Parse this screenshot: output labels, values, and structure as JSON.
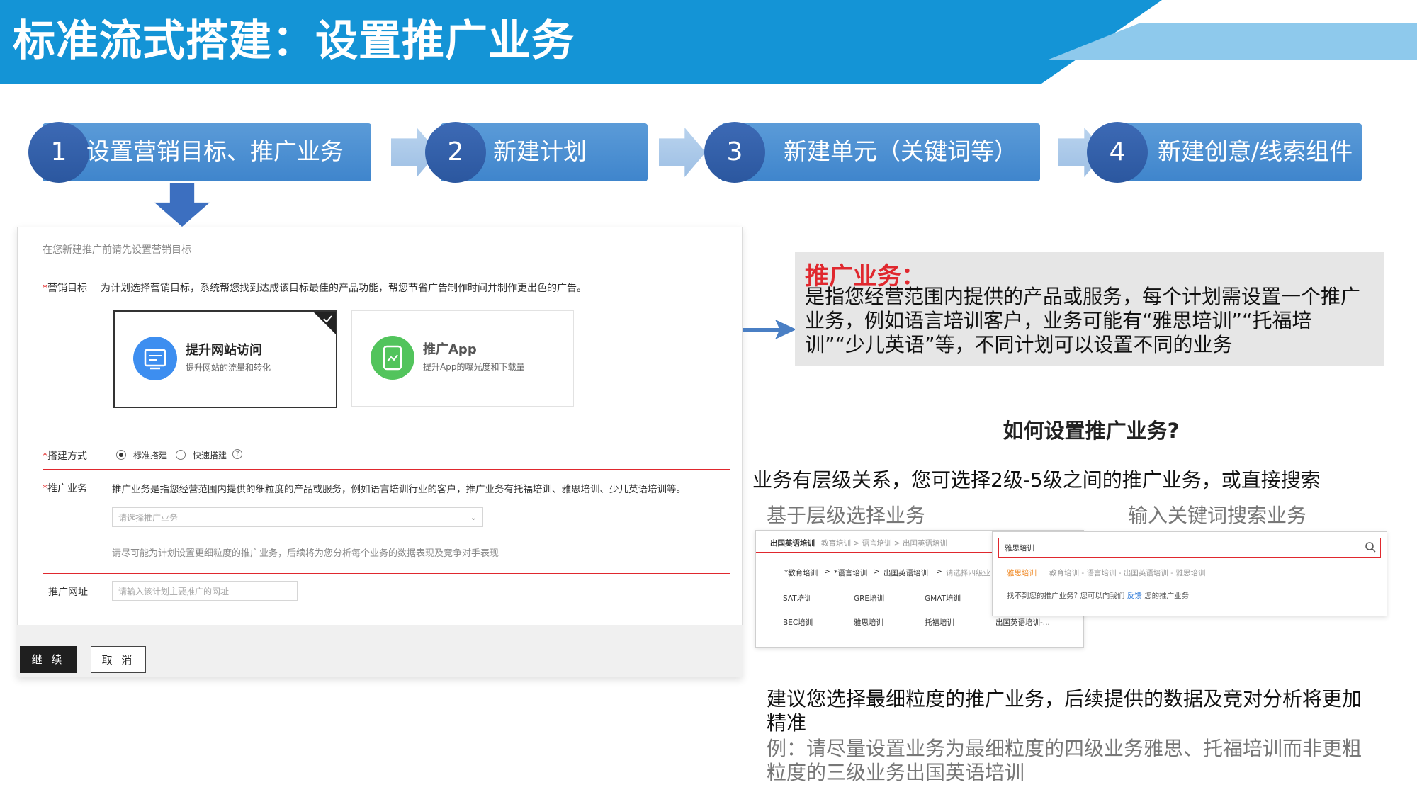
{
  "header": {
    "title": "标准流式搭建：设置推广业务"
  },
  "steps": [
    {
      "num": "1",
      "label": "设置营销目标、推广业务"
    },
    {
      "num": "2",
      "label": "新建计划"
    },
    {
      "num": "3",
      "label": "新建单元（关键词等）"
    },
    {
      "num": "4",
      "label": "新建创意/线索组件"
    }
  ],
  "form": {
    "intro": "在您新建推广前请先设置营销目标",
    "goal_label": "营销目标",
    "goal_desc": "为计划选择营销目标，系统帮您找到达成该目标最佳的产品功能，帮您节省广告制作时间并制作更出色的广告。",
    "cards": [
      {
        "title": "提升网站访问",
        "subtitle": "提升网站的流量和转化",
        "icon": "monitor-icon",
        "color": "#3d8ef0"
      },
      {
        "title": "推广App",
        "subtitle": "提升App的曝光度和下载量",
        "icon": "app-icon",
        "color": "#52c45c"
      }
    ],
    "build_label": "搭建方式",
    "build_options": [
      "标准搭建",
      "快速搭建"
    ],
    "business_label": "推广业务",
    "business_desc": "推广业务是指您经营范围内提供的细粒度的产品或服务，例如语言培训行业的客户，推广业务有托福培训、雅思培训、少儿英语培训等。",
    "business_placeholder": "请选择推广业务",
    "business_hint": "请尽可能为计划设置更细粒度的推广业务，后续将为您分析每个业务的数据表现及竞争对手表现",
    "url_label": "推广网址",
    "url_placeholder": "请输入该计划主要推广的网址",
    "continue_button": "继 续",
    "cancel_button": "取 消"
  },
  "definition": {
    "title": "推广业务：",
    "text": "是指您经营范围内提供的产品或服务，每个计划需设置一个推广业务，例如语言培训客户，业务可能有“雅思培训”“托福培训”“少儿英语”等，不同计划可以设置不同的业务"
  },
  "how_to": {
    "title": "如何设置推广业务?",
    "desc": "业务有层级关系，您可选择2级-5级之间的推广业务，或直接搜索",
    "left_label": "基于层级选择业务",
    "right_label": "输入关键词搜索业务"
  },
  "hierarchy_panel": {
    "selected": "出国英语培训",
    "path": "教育培训 > 语言培训 > 出国英语培训",
    "crumbs": [
      "*教育培训",
      "*语言培训",
      "出国英语培训",
      "请选择四级业"
    ],
    "items": [
      "SAT培训",
      "GRE培训",
      "GMAT培训",
      "BEC培训",
      "雅思培训",
      "托福培训",
      "出国英语培训-..."
    ]
  },
  "search_panel": {
    "query": "雅思培训",
    "result_name": "雅思培训",
    "result_path": "教育培训 - 语言培训 - 出国英语培训 - 雅思培训",
    "not_found": "找不到您的推广业务? 您可以向我们",
    "feedback_link": "反馈",
    "not_found_suffix": "您的推广业务"
  },
  "advice": {
    "main": "建议您选择最细粒度的推广业务，后续提供的数据及竞对分析将更加精准",
    "example": "例：请尽量设置业务为最细粒度的四级业务雅思、托福培训而非更粗粒度的三级业务出国英语培训"
  }
}
